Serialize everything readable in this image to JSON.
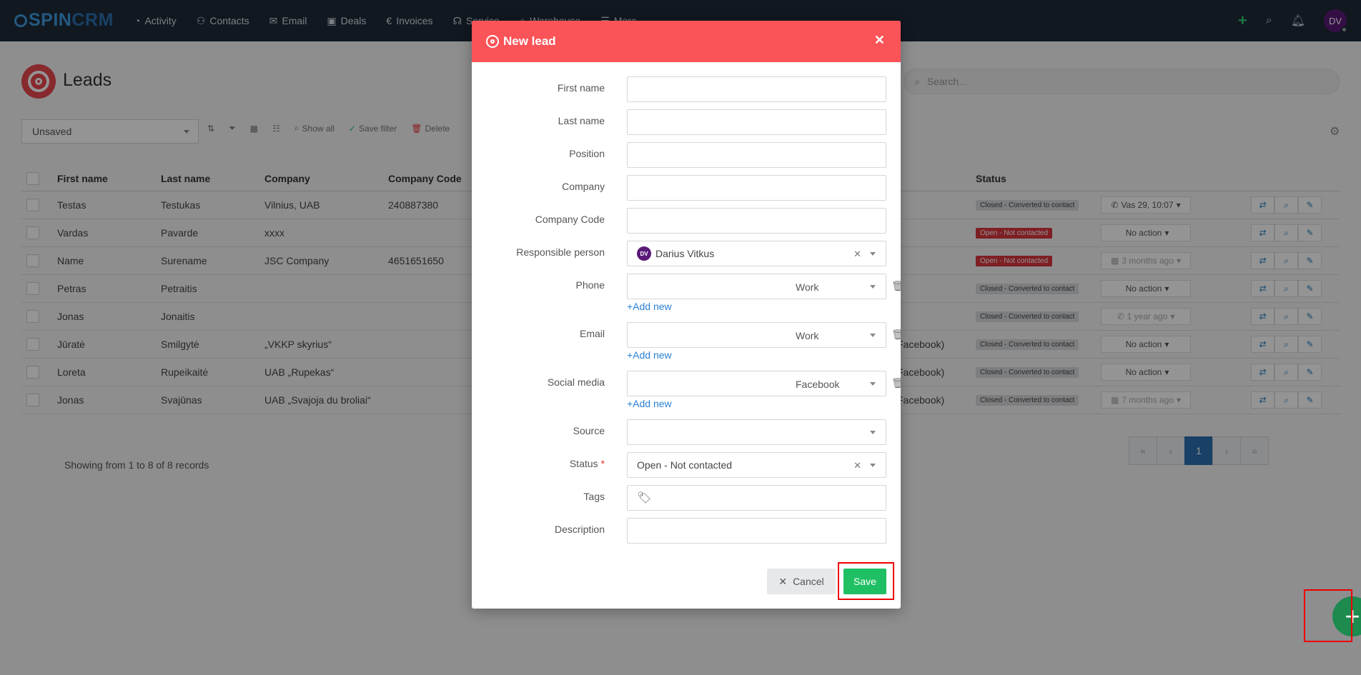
{
  "app": {
    "logo_spin": "SPIN",
    "logo_crm": "CRM",
    "avatar": "DV"
  },
  "nav": [
    "Activity",
    "Contacts",
    "Email",
    "Deals",
    "Invoices",
    "Service",
    "Warehouse",
    "More"
  ],
  "page": {
    "title": "Leads",
    "search_placeholder": "Search..."
  },
  "filter": {
    "selected": "Unsaved",
    "show_all": "Show all",
    "save_filter": "Save filter",
    "delete": "Delete"
  },
  "table": {
    "headers": [
      "First name",
      "Last name",
      "Company",
      "Company Code",
      "Status"
    ],
    "rows": [
      {
        "first": "Testas",
        "last": "Testukas",
        "company": "Vilnius, UAB",
        "code": "240887380",
        "extra": "",
        "status": "Closed - Converted to contact",
        "action": "Vas 29, 10:07"
      },
      {
        "first": "Vardas",
        "last": "Pavarde",
        "company": "xxxx",
        "code": "",
        "extra": "",
        "status": "Open - Not contacted",
        "action": "No action"
      },
      {
        "first": "Name",
        "last": "Surename",
        "company": "JSC Company",
        "code": "4651651650",
        "extra": "",
        "status": "Open - Not contacted",
        "action": "3 months ago"
      },
      {
        "first": "Petras",
        "last": "Petraitis",
        "company": "",
        "code": "",
        "extra": "",
        "status": "Closed - Converted to contact",
        "action": "No action"
      },
      {
        "first": "Jonas",
        "last": "Jonaitis",
        "company": "",
        "code": "",
        "extra": "",
        "status": "Closed - Converted to contact",
        "action": "1 year ago"
      },
      {
        "first": "Jūratė",
        "last": "Smilgytė",
        "company": "„VKKP skyrius“",
        "code": "",
        "extra": "Facebook)",
        "status": "Closed - Converted to contact",
        "action": "No action"
      },
      {
        "first": "Loreta",
        "last": "Rupeikaitė",
        "company": "UAB „Rupekas“",
        "code": "",
        "extra": "Facebook)",
        "status": "Closed - Converted to contact",
        "action": "No action"
      },
      {
        "first": "Jonas",
        "last": "Svajūnas",
        "company": "UAB „Svajoja du broliai“",
        "code": "",
        "extra": "Facebook)",
        "status": "Closed - Converted to contact",
        "action": "7 months ago"
      }
    ],
    "records_text": "Showing from 1 to 8 of 8 records",
    "page_current": "1"
  },
  "modal": {
    "title": "New lead",
    "labels": {
      "first_name": "First name",
      "last_name": "Last name",
      "position": "Position",
      "company": "Company",
      "company_code": "Company Code",
      "responsible": "Responsible person",
      "phone": "Phone",
      "email": "Email",
      "social": "Social media",
      "source": "Source",
      "status": "Status",
      "tags": "Tags",
      "description": "Description"
    },
    "values": {
      "responsible": "Darius Vitkus",
      "responsible_initials": "DV",
      "phone_type": "Work",
      "email_type": "Work",
      "social_type": "Facebook",
      "status": "Open - Not contacted"
    },
    "add_new": "+Add new",
    "cancel": "Cancel",
    "save": "Save"
  },
  "colors": {
    "modal_header": "#fa5358",
    "save": "#1fbf63",
    "fab": "#1d8a4e",
    "topbar": "#1e2a38"
  }
}
